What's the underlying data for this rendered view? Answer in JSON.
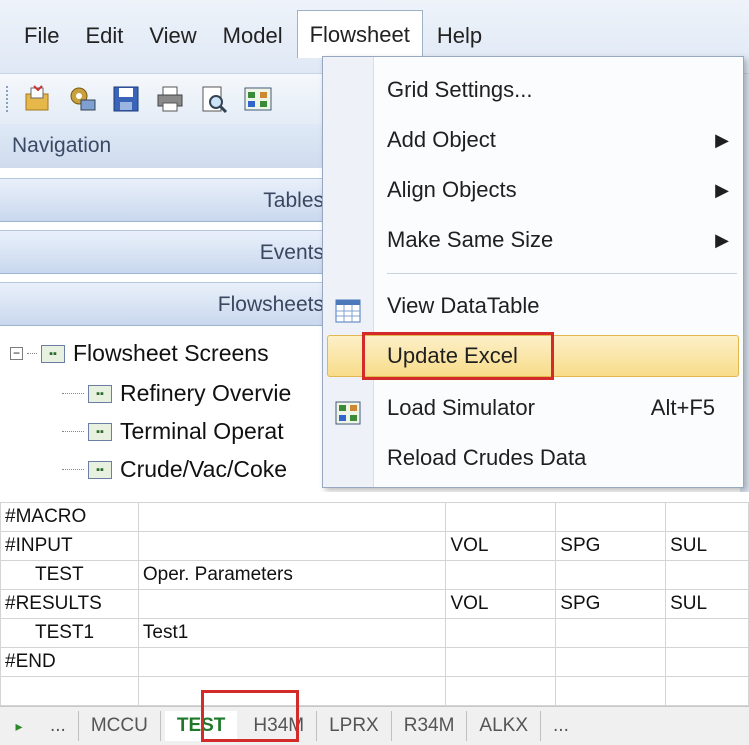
{
  "menubar": {
    "items": [
      "File",
      "Edit",
      "View",
      "Model",
      "Flowsheet",
      "Help"
    ],
    "open_item": "Flowsheet"
  },
  "navigation": {
    "title": "Navigation",
    "buttons": [
      "Tables",
      "Events",
      "Flowsheets"
    ],
    "tree": {
      "root": "Flowsheet Screens",
      "children": [
        "Refinery Overvie",
        "Terminal Operat",
        "Crude/Vac/Coke"
      ]
    }
  },
  "flowsheet_menu": {
    "items": [
      {
        "label": "Grid Settings...",
        "submenu": false
      },
      {
        "label": "Add Object",
        "submenu": true
      },
      {
        "label": "Align Objects",
        "submenu": true
      },
      {
        "label": "Make Same Size",
        "submenu": true
      },
      {
        "label": "View DataTable",
        "icon": "table-icon"
      },
      {
        "label": "Update Excel",
        "highlighted": true
      },
      {
        "label": "Load Simulator",
        "icon": "simulator-icon",
        "shortcut": "Alt+F5"
      },
      {
        "label": "Reload Crudes Data"
      }
    ]
  },
  "sheet": {
    "rows": [
      [
        "#MACRO",
        "",
        "",
        "",
        ""
      ],
      [
        "#INPUT",
        "",
        "VOL",
        "SPG",
        "SUL"
      ],
      [
        "TEST",
        "Oper. Parameters",
        "",
        "",
        ""
      ],
      [
        "#RESULTS",
        "",
        "VOL",
        "SPG",
        "SUL"
      ],
      [
        "TEST1",
        "Test1",
        "",
        "",
        ""
      ],
      [
        "#END",
        "",
        "",
        "",
        ""
      ],
      [
        "",
        "",
        "",
        "",
        ""
      ]
    ]
  },
  "sheet_tabs": {
    "nav": "▸",
    "items": [
      "...",
      "MCCU",
      "TEST",
      "H34M",
      "LPRX",
      "R34M",
      "ALKX",
      "..."
    ],
    "active": "TEST"
  },
  "colors": {
    "highlight_fill": "#f8dc8a",
    "annotation_red": "#d32a2a",
    "active_tab_green": "#1e7a2a"
  }
}
